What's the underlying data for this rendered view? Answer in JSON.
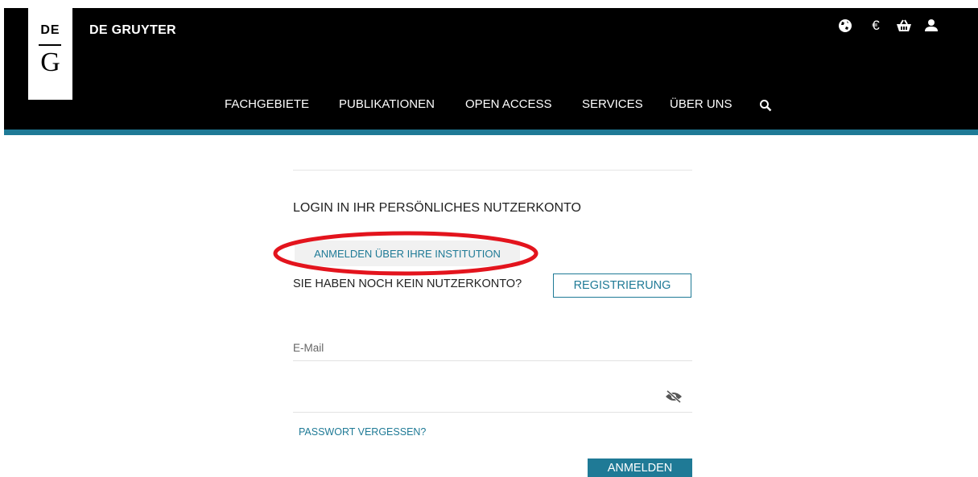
{
  "header": {
    "logo_top": "DE",
    "logo_bottom": "G",
    "brand_name": "DE GRUYTER",
    "icons": [
      "globe-icon",
      "euro-icon",
      "basket-icon",
      "user-icon"
    ],
    "euro_symbol": "€"
  },
  "nav": {
    "items": [
      "FACHGEBIETE",
      "PUBLIKATIONEN",
      "OPEN ACCESS",
      "SERVICES",
      "ÜBER UNS"
    ],
    "search_icon": "search-icon"
  },
  "login": {
    "title": "LOGIN IN IHR PERSÖNLICHES NUTZERKONTO",
    "institution_button": "ANMELDEN ÜBER IHRE INSTITUTION",
    "no_account_text": "SIE HABEN NOCH KEIN NUTZERKONTO?",
    "register_button": "REGISTRIERUNG",
    "email_label": "E-Mail",
    "password_toggle_icon": "eye-slash-icon",
    "forgot_password": "PASSWORT VERGESSEN?",
    "submit_button": "ANMELDEN"
  },
  "colors": {
    "accent": "#1f7a96",
    "header_bg": "#000000",
    "highlight_annotation": "#e3141d"
  }
}
